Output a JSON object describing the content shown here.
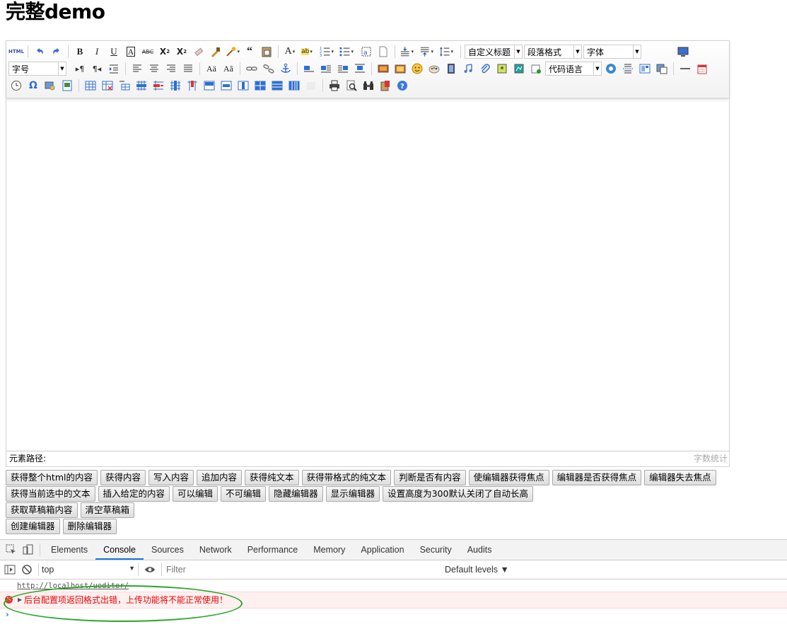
{
  "page": {
    "title": "完整demo"
  },
  "toolbar": {
    "row1": {
      "buttons": [
        "source-icon",
        "undo-icon",
        "redo-icon",
        "bold-icon",
        "italic-icon",
        "underline-icon",
        "font-border-icon",
        "strikethrough-icon",
        "superscript-icon",
        "subscript-icon",
        "remove-format-icon",
        "format-match-icon",
        "auto-typeset-icon",
        "blockquote-icon",
        "paste-plain-icon",
        "font-color-icon",
        "background-color-icon",
        "ordered-list-icon",
        "unordered-list-icon",
        "select-all-icon",
        "clear-doc-icon",
        "row-spacing-top-icon",
        "row-spacing-bottom-icon",
        "line-height-icon",
        "fullscreen-icon"
      ],
      "source_label": "HTML",
      "custom_title": "自定义标题",
      "paragraph": "段落格式",
      "font_family": "字体"
    },
    "row2": {
      "font_size": "字号",
      "code_lang": "代码语言"
    }
  },
  "status": {
    "path_label": "元素路径:",
    "word_count": "字数统计"
  },
  "buttons": {
    "row1": [
      "获得整个html的内容",
      "获得内容",
      "写入内容",
      "追加内容",
      "获得纯文本",
      "获得带格式的纯文本",
      "判断是否有内容",
      "使编辑器获得焦点",
      "编辑器是否获得焦点",
      "编辑器失去焦点"
    ],
    "row2": [
      "获得当前选中的文本",
      "插入给定的内容",
      "可以编辑",
      "不可编辑",
      "隐藏编辑器",
      "显示编辑器",
      "设置高度为300默认关闭了自动长高"
    ],
    "row3": [
      "获取草稿箱内容",
      "清空草稿箱"
    ],
    "row4": [
      "创建编辑器",
      "删除编辑器"
    ]
  },
  "devtools": {
    "tabs": [
      "Elements",
      "Console",
      "Sources",
      "Network",
      "Performance",
      "Memory",
      "Application",
      "Security",
      "Audits"
    ],
    "active_tab": "Console",
    "context": "top",
    "filter_placeholder": "Filter",
    "levels": "Default levels ▼",
    "log_url": "http://localhost/ueditor/",
    "error_message": "后台配置项返回格式出错，上传功能将不能正常使用！",
    "prompt": "›"
  },
  "colors": {
    "annotation": "#2aa52a",
    "error": "#e00000",
    "active_tab": "#1a73e8"
  }
}
